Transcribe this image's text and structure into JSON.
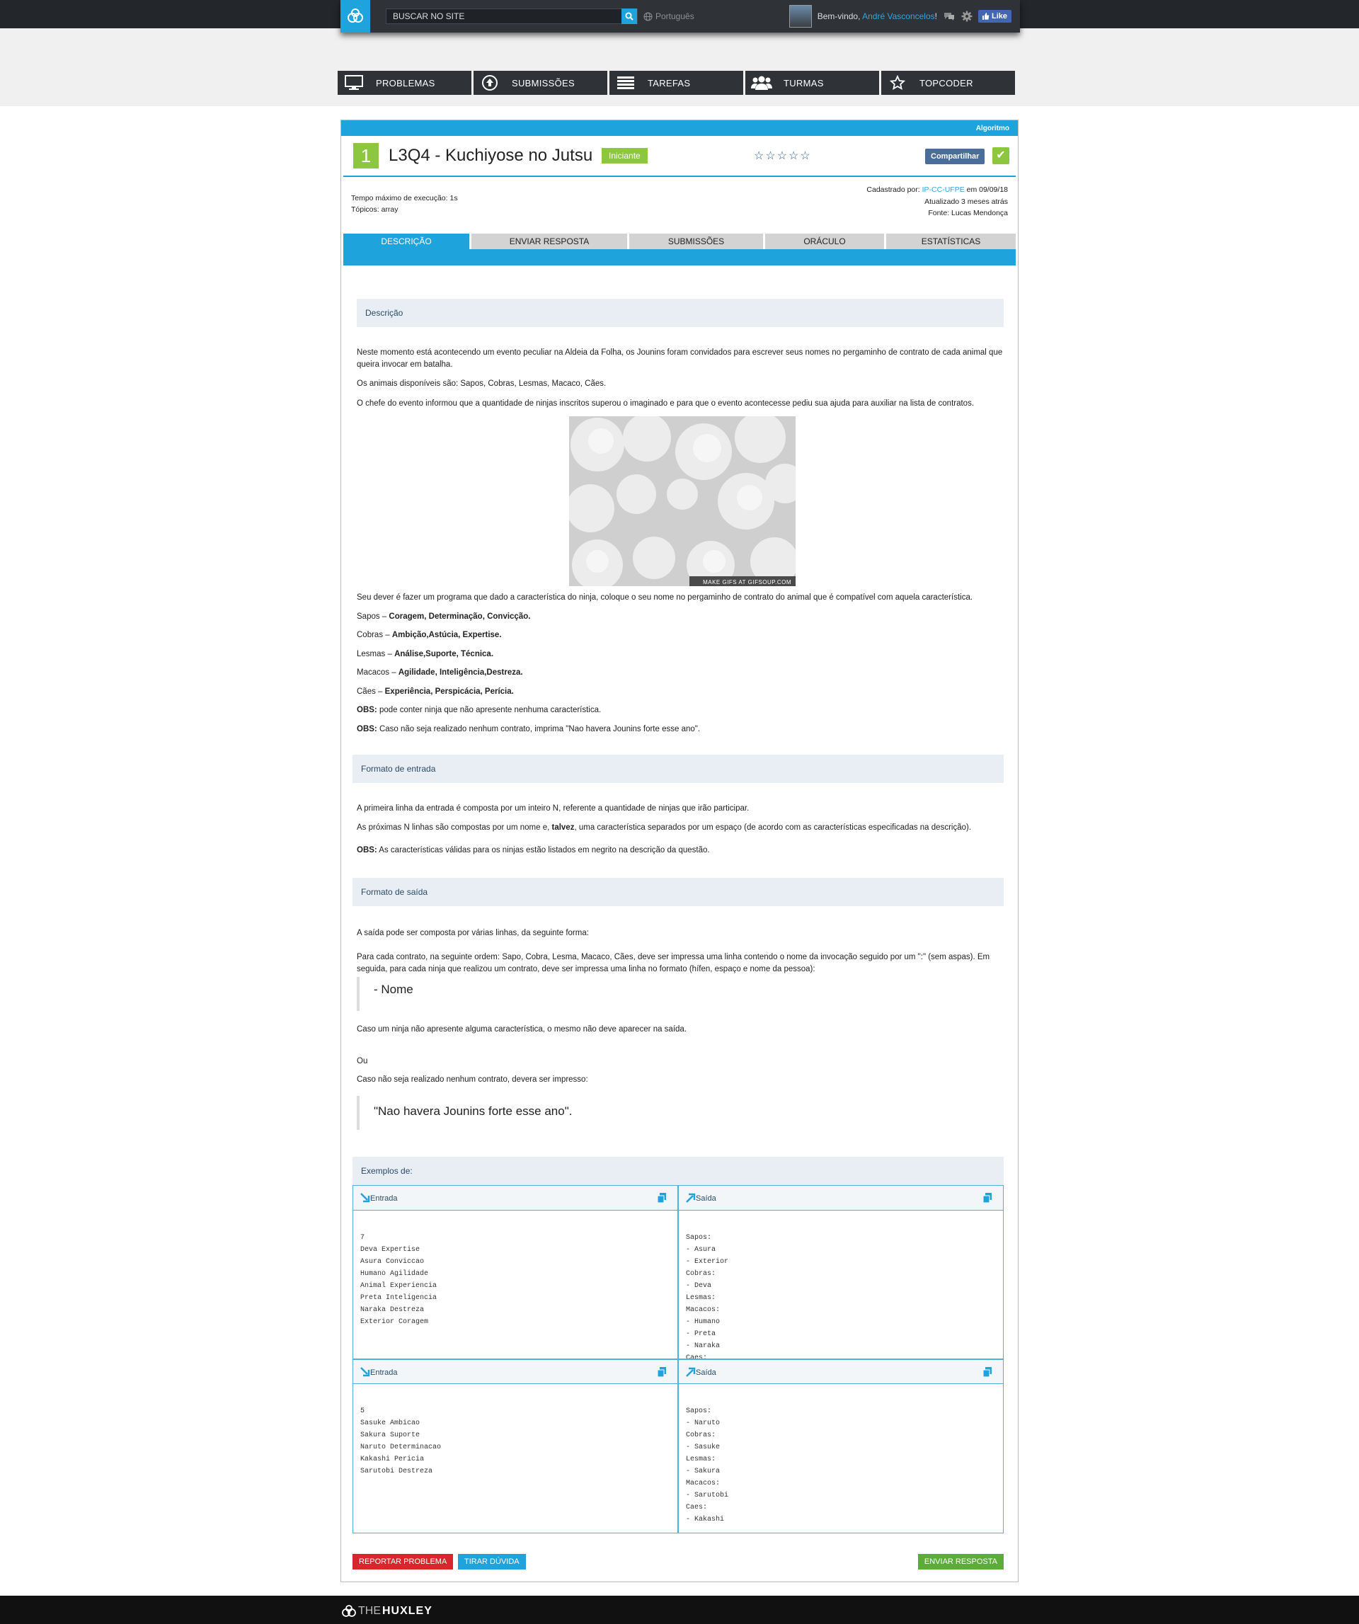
{
  "topbar": {
    "search_placeholder": "BUSCAR NO SITE",
    "language": "Português",
    "welcome_prefix": "Bem-vindo, ",
    "user_name": "André Vasconcelos",
    "welcome_suffix": "!",
    "like_label": "Like"
  },
  "nav": [
    {
      "label": "PROBLEMAS",
      "icon": "monitor-icon"
    },
    {
      "label": "SUBMISSÕES",
      "icon": "upload-circle-icon"
    },
    {
      "label": "TAREFAS",
      "icon": "list-icon"
    },
    {
      "label": "TURMAS",
      "icon": "group-icon"
    },
    {
      "label": "TOPCODER",
      "icon": "star-icon"
    }
  ],
  "problem": {
    "category": "Algoritmo",
    "number": "1",
    "title": "L3Q4 - Kuchiyose no Jutsu",
    "level": "Iniciante",
    "stars": "☆☆☆☆☆",
    "share_label": "Compartilhar",
    "time_limit": "Tempo máximo de execução: 1s",
    "topics": "Tópicos: array",
    "registered_prefix": "Cadastrado por: ",
    "registered_by": "IP-CC-UFPE",
    "registered_suffix": " em 09/09/18",
    "updated": "Atualizado 3 meses atrás",
    "source": "Fonte: Lucas Mendonça"
  },
  "tabs": [
    "DESCRIÇÃO",
    "ENVIAR RESPOSTA",
    "SUBMISSÕES",
    "ORÁCULO",
    "ESTATÍSTICAS"
  ],
  "description": {
    "heading": "Descrição",
    "p1": "Neste momento está acontecendo um evento peculiar na Aldeia da Folha, os Jounins foram convidados para escrever seus nomes no pergaminho de contrato de cada animal que queira invocar em batalha.",
    "p2": "Os animais disponíveis são: Sapos, Cobras, Lesmas, Macaco, Cães.",
    "p3": "O chefe do evento informou que a quantidade de ninjas inscritos superou o imaginado e para que o evento acontecesse pediu sua ajuda para auxiliar na lista de contratos.",
    "gif_caption": "MAKE GIFS AT GIFSOUP.COM",
    "p4": "Seu dever é fazer um programa que dado a característica do ninja, coloque o seu nome no pergaminho de contrato do animal que é compatível com aquela característica.",
    "animals": [
      {
        "name": "Sapos – ",
        "traits": "Coragem, Determinação, Convicção."
      },
      {
        "name": "Cobras – ",
        "traits": "Ambição,Astúcia, Expertise."
      },
      {
        "name": "Lesmas – ",
        "traits": "Análise,Suporte, Técnica."
      },
      {
        "name": "Macacos – ",
        "traits": "Agilidade, Inteligência,Destreza."
      },
      {
        "name": "Cães – ",
        "traits": "Experiência, Perspicácia, Perícia."
      }
    ],
    "obs_label": "OBS:",
    "obs1": " pode conter ninja que não apresente nenhuma característica.",
    "obs2": " Caso não seja realizado nenhum contrato, imprima \"Nao havera Jounins forte esse ano\"."
  },
  "input_format": {
    "heading": "Formato de entrada",
    "p1": "A primeira linha da entrada é composta por um inteiro N, referente a quantidade de ninjas que irão participar.",
    "p2_a": "As próximas N linhas são compostas por um nome e, ",
    "p2_b": "talvez",
    "p2_c": ", uma característica separados por um espaço (de acordo com as características especificadas na descrição).",
    "obs_label": "OBS:",
    "obs": " As características válidas para os ninjas estão listados em negrito na descrição da questão."
  },
  "output_format": {
    "heading": "Formato de saída",
    "p1": "A saída pode ser composta por várias linhas, da seguinte forma:",
    "p2": "Para cada contrato, na seguinte ordem: Sapo, Cobra, Lesma, Macaco, Cães, deve ser impressa uma linha contendo o nome da invocação seguido por um \":\" (sem aspas). Em seguida, para cada ninja que realizou um contrato, deve ser impressa uma linha no formato (hífen, espaço e nome da pessoa):",
    "quote1": "- Nome",
    "p3": "Caso um ninja não apresente alguma característica, o mesmo não deve aparecer na saída.",
    "or": "Ou",
    "p4": "Caso não seja realizado nenhum contrato, devera ser impresso:",
    "quote2": "\"Nao havera Jounins forte esse ano\"."
  },
  "examples": {
    "heading": "Exemplos de:",
    "input_label": "Entrada",
    "output_label": "Saída",
    "items": [
      {
        "input": "7\nDeva Expertise\nAsura Conviccao\nHumano Agilidade\nAnimal Experiencia\nPreta Inteligencia\nNaraka Destreza\nExterior Coragem",
        "output": "Sapos:\n- Asura\n- Exterior\nCobras:\n- Deva\nLesmas:\nMacacos:\n- Humano\n- Preta\n- Naraka\nCaes:\n- Animal"
      },
      {
        "input": "5\nSasuke Ambicao\nSakura Suporte\nNaruto Determinacao\nKakashi Pericia\nSarutobi Destreza",
        "output": "Sapos:\n- Naruto\nCobras:\n- Sasuke\nLesmas:\n- Sakura\nMacacos:\n- Sarutobi\nCaes:\n- Kakashi"
      }
    ]
  },
  "buttons": {
    "report": "REPORTAR PROBLEMA",
    "doubt": "TIRAR DÚVIDA",
    "submit": "ENVIAR RESPOSTA"
  },
  "footer": {
    "logo_a": "THE",
    "logo_b": "HUXLEY"
  },
  "colors": {
    "accent": "#1ea3dc",
    "level_green": "#8dc63f",
    "report_red": "#d9262c",
    "submit_green": "#5cac3a"
  }
}
